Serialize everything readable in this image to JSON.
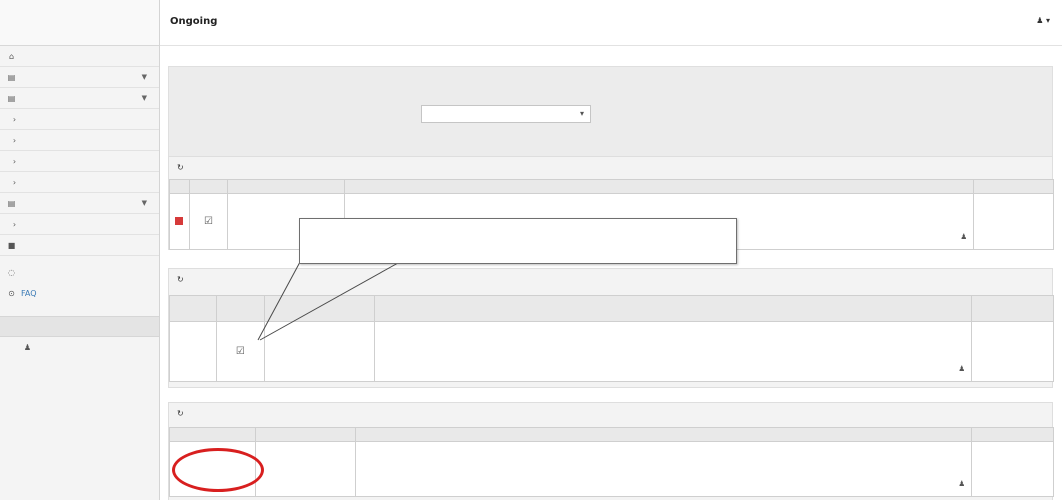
{
  "sidebar": {
    "brand": "",
    "items": [
      {
        "label": "",
        "icon": "home-icon"
      },
      {
        "label": "",
        "icon": "list-icon"
      },
      {
        "label": "",
        "icon": "list-icon"
      },
      {
        "label": "",
        "icon": "chevron-right-icon"
      },
      {
        "label": "",
        "icon": "chevron-right-icon"
      },
      {
        "label": "",
        "icon": "chevron-right-icon"
      },
      {
        "label": "",
        "icon": "chevron-right-icon"
      },
      {
        "label": "",
        "icon": "list-icon"
      },
      {
        "label": "",
        "icon": "chevron-right-icon"
      },
      {
        "label": "",
        "icon": "user-icon"
      },
      {
        "label": "",
        "icon": "link-icon"
      },
      {
        "label": "FAQ",
        "icon": "help-icon"
      }
    ],
    "section_label": "",
    "section_item": ""
  },
  "header": {
    "title_prefix": "",
    "title_bold": "Ongoing",
    "user_text": ""
  },
  "filter": {
    "label": "",
    "value": ""
  },
  "panel1": {
    "title": "",
    "columns": [
      "",
      "",
      "",
      "",
      ""
    ],
    "rows": [
      {
        "action": "",
        "project_link": "",
        "project_sub": "",
        "owner": "",
        "status": ""
      }
    ]
  },
  "panel2": {
    "title": "",
    "columns": [
      "",
      "",
      "",
      "",
      ""
    ],
    "rows": [
      {
        "action": "",
        "number": "",
        "project_link": "",
        "project_sub": "",
        "owner": "",
        "status": ""
      }
    ]
  },
  "panel3": {
    "title": "",
    "columns": [
      "",
      "",
      "",
      ""
    ],
    "rows": [
      {
        "action_link": "",
        "number": "",
        "project_link": "",
        "project_sub": "",
        "owner": "",
        "status": ""
      }
    ]
  },
  "callout": {
    "text": ""
  },
  "colors": {
    "accent_link": "#5a84b6",
    "red_marker": "#d81f1f",
    "green_link": "#3aa35e"
  }
}
